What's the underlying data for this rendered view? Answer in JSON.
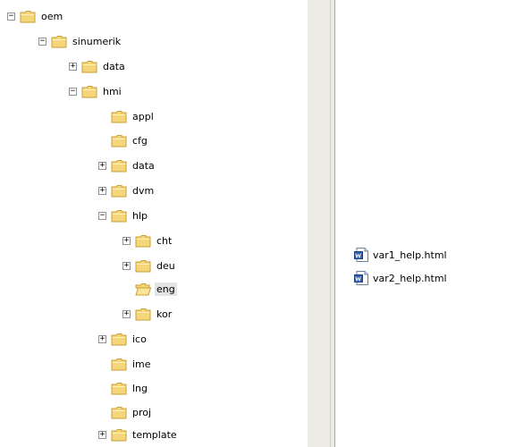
{
  "tree": {
    "nodes": [
      {
        "label": "oem",
        "expander": "−"
      },
      {
        "label": "sinumerik",
        "expander": "−"
      },
      {
        "label": "data",
        "expander": "+"
      },
      {
        "label": "hmi",
        "expander": "−"
      },
      {
        "label": "appl",
        "expander": ""
      },
      {
        "label": "cfg",
        "expander": ""
      },
      {
        "label": "data",
        "expander": "+"
      },
      {
        "label": "dvm",
        "expander": "+"
      },
      {
        "label": "hlp",
        "expander": "−"
      },
      {
        "label": "cht",
        "expander": "+"
      },
      {
        "label": "deu",
        "expander": "+"
      },
      {
        "label": "eng",
        "expander": "",
        "selected": true
      },
      {
        "label": "kor",
        "expander": "+"
      },
      {
        "label": "ico",
        "expander": "+"
      },
      {
        "label": "ime",
        "expander": ""
      },
      {
        "label": "lng",
        "expander": ""
      },
      {
        "label": "proj",
        "expander": ""
      },
      {
        "label": "template",
        "expander": "+"
      }
    ]
  },
  "files": {
    "items": [
      {
        "label": "var1_help.html",
        "icon": "word-document-icon"
      },
      {
        "label": "var2_help.html",
        "icon": "word-document-icon"
      }
    ]
  },
  "colors": {
    "folder_fill": "#f5d67b",
    "folder_stroke": "#c8a034",
    "selection": "#e3e3e3",
    "splitter": "#ecebe4"
  }
}
